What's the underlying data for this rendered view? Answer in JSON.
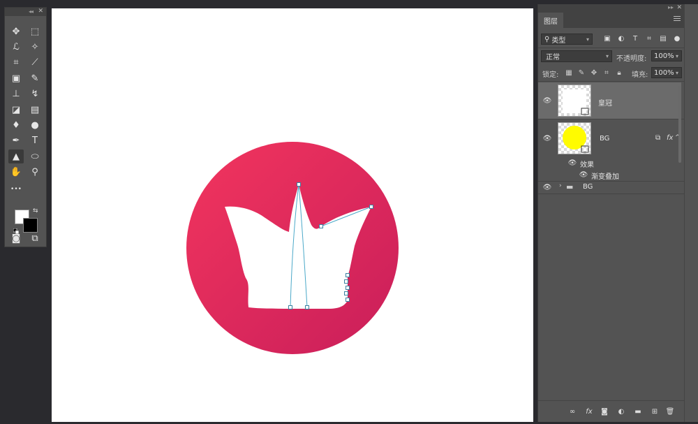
{
  "tools": {
    "items": [
      {
        "name": "move-tool",
        "glyph": "✥"
      },
      {
        "name": "marquee-tool",
        "glyph": "⬚"
      },
      {
        "name": "lasso-tool",
        "glyph": "ℒ"
      },
      {
        "name": "magic-wand-tool",
        "glyph": "✧"
      },
      {
        "name": "crop-tool",
        "glyph": "⌗"
      },
      {
        "name": "eyedropper-tool",
        "glyph": "⟋"
      },
      {
        "name": "healing-tool",
        "glyph": "▣"
      },
      {
        "name": "brush-tool",
        "glyph": "✎"
      },
      {
        "name": "stamp-tool",
        "glyph": "⊥"
      },
      {
        "name": "history-brush-tool",
        "glyph": "↯"
      },
      {
        "name": "eraser-tool",
        "glyph": "◪"
      },
      {
        "name": "gradient-tool",
        "glyph": "▤"
      },
      {
        "name": "blur-tool",
        "glyph": "♦"
      },
      {
        "name": "dodge-tool",
        "glyph": "●"
      },
      {
        "name": "pen-tool",
        "glyph": "✒"
      },
      {
        "name": "type-tool",
        "glyph": "T"
      },
      {
        "name": "path-selection-tool",
        "glyph": "▲"
      },
      {
        "name": "ellipse-tool",
        "glyph": "⬭"
      },
      {
        "name": "hand-tool",
        "glyph": "✋"
      },
      {
        "name": "zoom-tool",
        "glyph": "⚲"
      },
      {
        "name": "more-tools",
        "glyph": "•••"
      },
      {
        "name": "quick-mask-tool",
        "glyph": "◙"
      },
      {
        "name": "screen-mode-tool",
        "glyph": "⧉"
      }
    ],
    "active": "path-selection-tool",
    "foreground_color": "#ffffff",
    "background_color": "#000000"
  },
  "canvas": {
    "circle_gradient": [
      "#f2355e",
      "#c91e5a"
    ],
    "shape_fill": "#ffffff",
    "path_color": "#4aa8c8"
  },
  "layers_panel": {
    "tab_label": "图层",
    "filter_label": "类型",
    "blend_mode": "正常",
    "opacity_label": "不透明度:",
    "opacity_value": "100%",
    "lock_label": "锁定:",
    "fill_label": "填充:",
    "fill_value": "100%",
    "layers": [
      {
        "name": "皇冠",
        "selected": true,
        "thumb": "white-shape",
        "visible": true
      },
      {
        "name": "BG",
        "selected": false,
        "thumb": "yellow-circle",
        "visible": true,
        "has_fx": true
      },
      {
        "name": "BG",
        "selected": false,
        "thumb": "folder",
        "visible": true
      }
    ],
    "effects_label": "效果",
    "effect_item": "渐变叠加",
    "fx_label": "fx"
  }
}
